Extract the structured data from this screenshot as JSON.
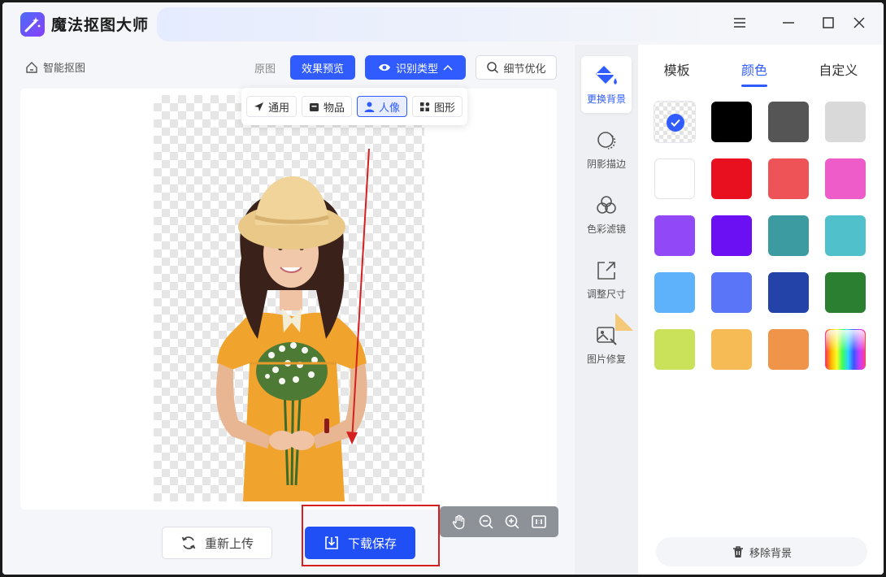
{
  "app": {
    "title": "魔法抠图大师"
  },
  "main": {
    "breadcrumb": "智能抠图",
    "toolbar": {
      "original_label": "原图",
      "preview_label": "效果预览",
      "recognize_label": "识别类型",
      "detail_label": "细节优化"
    },
    "recognize_options": [
      {
        "label": "通用",
        "icon": "send-arrow-icon",
        "selected": false
      },
      {
        "label": "物品",
        "icon": "box-icon",
        "selected": false
      },
      {
        "label": "人像",
        "icon": "person-icon",
        "selected": true
      },
      {
        "label": "图形",
        "icon": "shapes-icon",
        "selected": false
      }
    ],
    "zoom_tools": [
      "hand-icon",
      "zoom-out-icon",
      "zoom-in-icon",
      "actual-size-icon"
    ],
    "reupload_label": "重新上传",
    "download_label": "下载保存"
  },
  "rail": {
    "items": [
      {
        "label": "更换背景",
        "icon": "paint-bucket-icon",
        "active": true
      },
      {
        "label": "阴影描边",
        "icon": "shadow-stroke-icon",
        "active": false
      },
      {
        "label": "色彩滤镜",
        "icon": "color-filter-icon",
        "active": false
      },
      {
        "label": "调整尺寸",
        "icon": "resize-icon",
        "active": false
      },
      {
        "label": "图片修复",
        "icon": "image-repair-icon",
        "active": false
      }
    ]
  },
  "panel": {
    "tabs": [
      {
        "label": "模板",
        "active": false
      },
      {
        "label": "颜色",
        "active": true
      },
      {
        "label": "自定义",
        "active": false
      }
    ],
    "colors": [
      "transparent",
      "#000000",
      "#555555",
      "#d9d9d9",
      "#ffffff",
      "#e8101e",
      "#ee5457",
      "#ee5cc9",
      "#9148f6",
      "#6a10f2",
      "#3b9ba0",
      "#50c0ca",
      "#5eb2fb",
      "#5b75f8",
      "#2343a8",
      "#2b7f31",
      "#c9e25a",
      "#f6bb55",
      "#ef9448",
      "rainbow"
    ],
    "selected_color_index": 0,
    "remove_bg_label": "移除背景"
  },
  "theme": {
    "accent": "#2f5bff",
    "annotation": "#d42020"
  }
}
